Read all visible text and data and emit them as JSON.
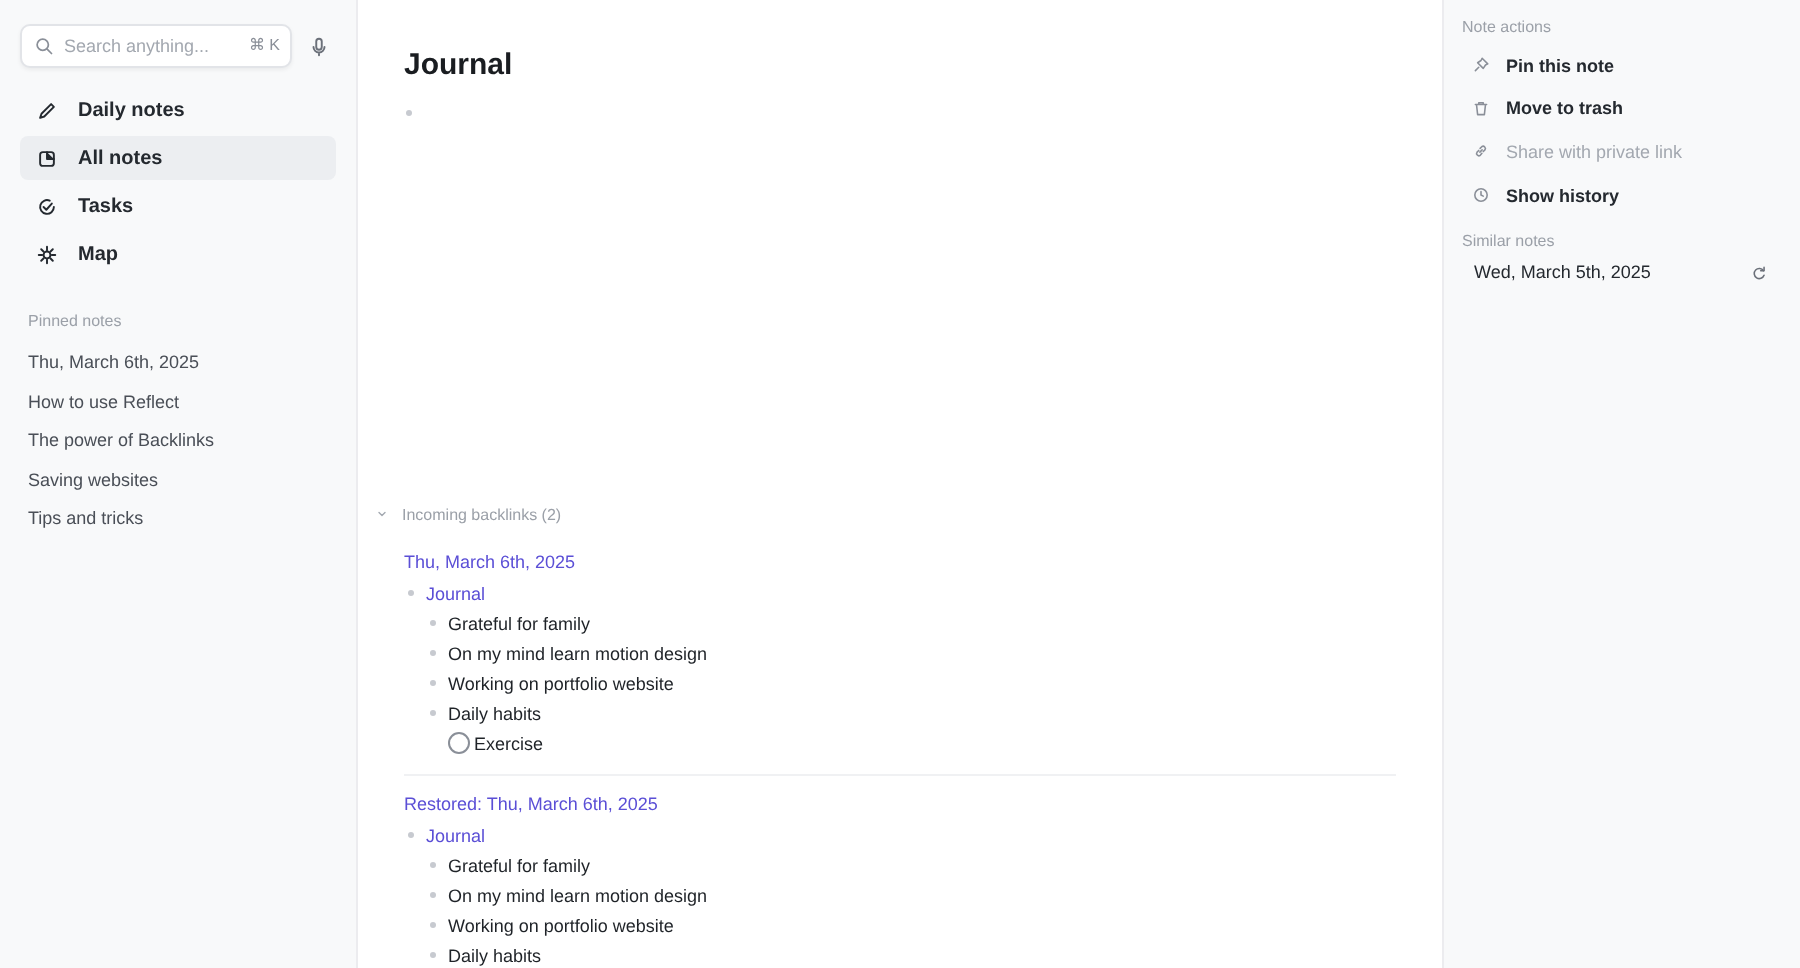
{
  "sidebar": {
    "search": {
      "placeholder": "Search anything...",
      "shortcut": "⌘ K"
    },
    "nav": [
      {
        "label": "Daily notes",
        "selected": false
      },
      {
        "label": "All notes",
        "selected": true
      },
      {
        "label": "Tasks",
        "selected": false
      },
      {
        "label": "Map",
        "selected": false
      }
    ],
    "pinned_heading": "Pinned notes",
    "pinned": [
      "Thu, March 6th, 2025",
      "How to use Reflect",
      "The power of Backlinks",
      "Saving websites",
      "Tips and tricks"
    ]
  },
  "note": {
    "title": "Journal",
    "backlinks": {
      "heading": "Incoming backlinks (2)",
      "expanded": true,
      "items": [
        {
          "title": "Thu, March 6th, 2025",
          "children": [
            {
              "text": "Journal",
              "kind": "link",
              "children": [
                {
                  "text": "Grateful for family",
                  "kind": "bullet"
                },
                {
                  "text": "On my mind learn motion design",
                  "kind": "bullet"
                },
                {
                  "text": "Working on portfolio website",
                  "kind": "bullet"
                },
                {
                  "text": "Daily habits",
                  "kind": "bullet",
                  "children": [
                    {
                      "text": "Exercise",
                      "kind": "task",
                      "checked": false
                    }
                  ]
                }
              ]
            }
          ]
        },
        {
          "title": "Restored: Thu, March 6th, 2025",
          "children": [
            {
              "text": "Journal",
              "kind": "link",
              "children": [
                {
                  "text": "Grateful for family",
                  "kind": "bullet"
                },
                {
                  "text": "On my mind learn motion design",
                  "kind": "bullet"
                },
                {
                  "text": "Working on portfolio website",
                  "kind": "bullet"
                },
                {
                  "text": "Daily habits",
                  "kind": "bullet"
                }
              ]
            }
          ]
        }
      ]
    }
  },
  "actions_panel": {
    "heading": "Note actions",
    "actions": [
      {
        "label": "Pin this note",
        "disabled": false
      },
      {
        "label": "Move to trash",
        "disabled": false
      },
      {
        "label": "Share with private link",
        "disabled": true
      },
      {
        "label": "Show history",
        "disabled": false
      }
    ],
    "similar_heading": "Similar notes",
    "similar": [
      "Wed, March 5th, 2025"
    ]
  }
}
